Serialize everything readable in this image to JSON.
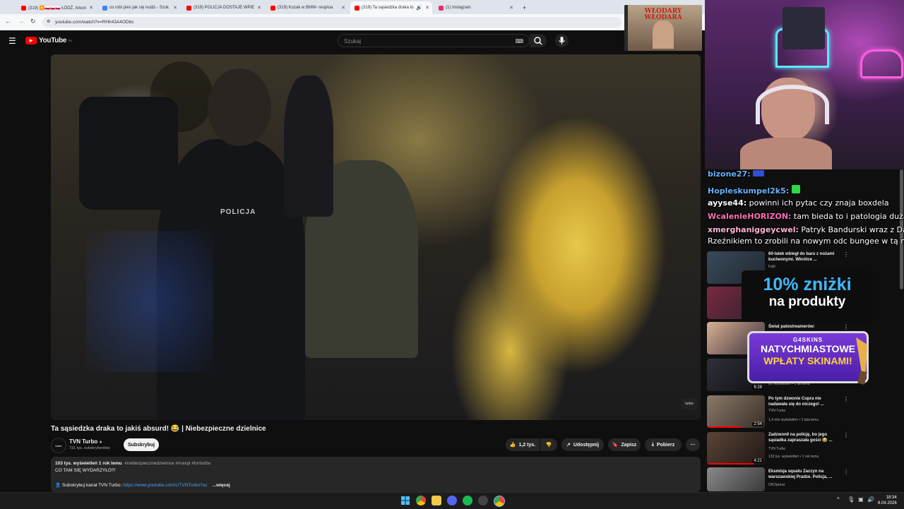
{
  "browser": {
    "tabs": [
      {
        "label": "(319) ▶️🇵🇱🇵🇱🇵🇱 ŁÓDŹ. Arkon",
        "color": "#ff0000"
      },
      {
        "label": "co robi pies jak się nudzi - Szuk",
        "color": "#4285f4"
      },
      {
        "label": "(319) POLICJA DOSTAJE WPIE",
        "color": "#ff0000"
      },
      {
        "label": "(319) Kozak w BMW- reuploa",
        "color": "#ff0000"
      },
      {
        "label": "(319) Ta sąsiedzka draka to",
        "color": "#ff0000"
      },
      {
        "label": "(1) Instagram",
        "color": "#e1306c"
      }
    ],
    "active_tab": 4,
    "new_tab": "+",
    "url": "youtube.com/watch?v=RHh43A4ODbc"
  },
  "youtube": {
    "logo": "YouTube",
    "logo_sup": "PL",
    "search_placeholder": "Szukaj",
    "video": {
      "title": "Ta sąsiedzka draka to jakiś absurd! 😂 | Niebezpieczne dzielnice",
      "watermark": "turbo"
    },
    "channel": {
      "name": "TVN Turbo",
      "subs": "731 tys. subskrybentów",
      "subscribe": "Subskrybuj"
    },
    "actions": {
      "likes": "1,2 tys.",
      "share": "Udostępnij",
      "save": "Zapisz",
      "download": "Pobierz"
    },
    "description": {
      "meta": "103 tys. wyświetleń  1 rok temu",
      "tags": "#niebezpiecznedzielnice #maxpl #tvnturbo",
      "line1": "CO TAM SIĘ WYDARZYŁO?!",
      "line2_prefix": "👤 Subskrybuj kanał TVN Turbo:",
      "line2_link": "https://www.youtube.com/c/TVNTurbo?su",
      "more": "...więcej"
    }
  },
  "overlay": {
    "badge_text": "WŁODARY WŁODARA",
    "chat": [
      {
        "user": "bizone27:",
        "color": "#6ab0ff",
        "text": ""
      },
      {
        "user": "Hopleskumpel2k5:",
        "color": "#6ab0ff",
        "text": ""
      },
      {
        "user": "ayyse44:",
        "color": "#ffffff",
        "text": "powinni ich pytac czy znaja boxdela"
      },
      {
        "user": "WcalenieHORIZON:",
        "color": "#ff6fb5",
        "text": "tam bieda to i patologia duża"
      },
      {
        "user": "xmerghaniggeycwel:",
        "color": "#ffb3d9",
        "text": "Patryk Bandurski wraz z Dawidem"
      },
      {
        "user": "",
        "color": "#ffffff",
        "text": "Rzeźnikiem to zrobili na nowym odc bungee w tą niedziele"
      }
    ],
    "promo1_line1": "10% zniżki",
    "promo1_line2": "na produkty",
    "promo2_brand": "G4SKINS",
    "promo2_line1": "NATYCHMIASTOWE",
    "promo2_line2": "WPŁATY SKINAMI!"
  },
  "recommended": [
    {
      "title": "60-latek wbiegł do baru z nożami kuchennymi. Wkrótce ...",
      "channel": "Fakt",
      "meta": "",
      "duration": "",
      "color": "#3a4a5a"
    },
    {
      "title": "",
      "channel": "",
      "meta": "",
      "duration": "",
      "color": "#5a3040"
    },
    {
      "title": "Świat patostreamerów:",
      "channel": "",
      "meta": "",
      "duration": "",
      "color": "#8a6a50"
    },
    {
      "title": "",
      "channel": "",
      "meta": "ys. wyświetleń • 1 lat temu",
      "duration": "6:28",
      "color": "#2a2a30"
    },
    {
      "title": "Po tym dzwonie Cupra nie nadawała się do niczego! ...",
      "channel": "TVN Turbo",
      "meta": "1,4 mln wyświetleń • 3 lata temu",
      "duration": "2:54",
      "color": "#6a5a4a"
    },
    {
      "title": "Zadzwonił na policję, bo jego sąsiadka zapraszała gości 😂 ...",
      "channel": "TVN Turbo",
      "meta": "133 tys. wyświetleń • 1 rok temu",
      "duration": "4:21",
      "color": "#4a3a30"
    },
    {
      "title": "Eksmisja squatu Zaczyn na warszawskiej Pradze. Policja, ...",
      "channel": "OKOpress",
      "meta": "",
      "duration": "",
      "color": "#6a6a6a"
    }
  ],
  "taskbar": {
    "time": "18:34",
    "date": "8.04.2026"
  }
}
